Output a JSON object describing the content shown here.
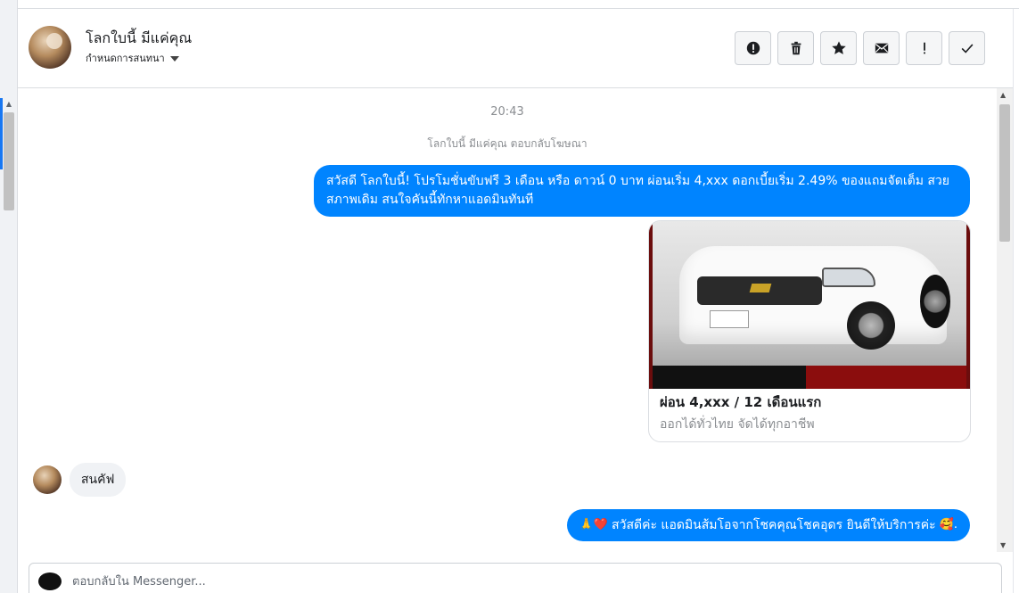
{
  "header": {
    "name": "โลกใบนี้ มีแค่คุณ",
    "assign_label": "กำหนดการสนทนา"
  },
  "actions": [
    {
      "name": "spam-button",
      "icon": "exclamation-circle-icon"
    },
    {
      "name": "delete-button",
      "icon": "trash-icon"
    },
    {
      "name": "star-button",
      "icon": "star-icon"
    },
    {
      "name": "mark-unread-button",
      "icon": "envelope-icon"
    },
    {
      "name": "follow-up-button",
      "icon": "exclamation-icon"
    },
    {
      "name": "mark-done-button",
      "icon": "check-icon"
    }
  ],
  "conversation": {
    "timestamp": "20:43",
    "ad_reply_note": "โลกใบนี้ มีแค่คุณ ตอบกลับโฆษณา",
    "outgoing_message_1": "สวัสดี โลกใบนี้! โปรโมชั่นขับฟรี 3 เดือน หรือ ดาวน์ 0 บาท ผ่อนเริ่ม 4,xxx ดอกเบี้ยเริ่ม 2.49% ของแถมจัดเต็ม สวยสภาพเดิม สนใจคันนี้ทักหาแอดมินทันที",
    "card": {
      "title": "ผ่อน 4,xxx / 12 เดือนแรก",
      "subtitle": "ออกได้ทั่วไทย จัดได้ทุกอาชีพ"
    },
    "incoming_message": "สนคัฟ",
    "outgoing_message_2": "สวัสดีค่ะ แอดมินส้มโอจากโชคคุณโชคอุดร ยินดีให้บริการค่ะ",
    "outgoing_message_2_prefix_emoji": "🙏❤️",
    "outgoing_message_2_suffix_emoji": "🥰."
  },
  "composer": {
    "placeholder": "ตอบกลับใน Messenger...",
    "value": ""
  },
  "colors": {
    "outgoing_bubble": "#0084ff",
    "incoming_bubble": "#f0f2f5",
    "border": "#dadde1"
  }
}
